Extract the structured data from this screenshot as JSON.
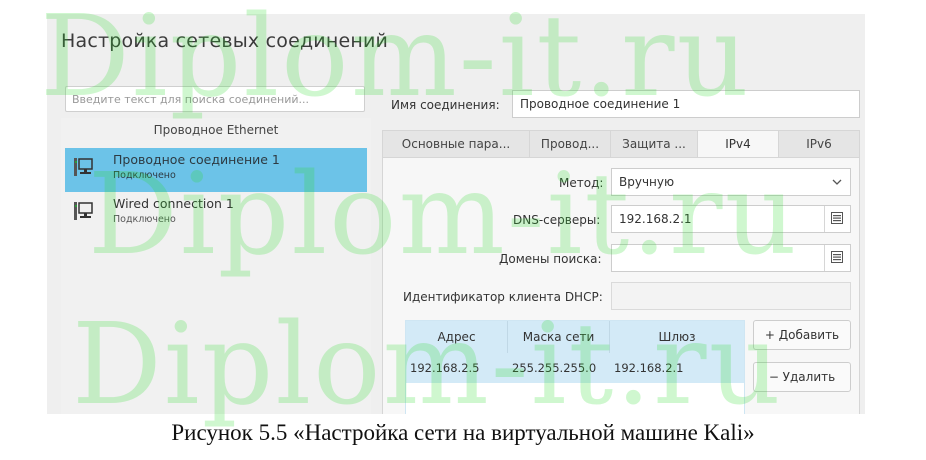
{
  "dialog": {
    "title": "Настройка сетевых соединений"
  },
  "search": {
    "placeholder": "Введите текст для поиска соединений..."
  },
  "connections": {
    "group_header": "Проводное Ethernet",
    "items": [
      {
        "name": "Проводное соединение 1",
        "status": "Подключено",
        "selected": true,
        "icon": "network-wired-icon"
      },
      {
        "name": "Wired connection 1",
        "status": "Подключено",
        "selected": false,
        "icon": "network-wired-icon"
      }
    ]
  },
  "editor": {
    "connection_name_label": "Имя соединения:",
    "connection_name_value": "Проводное соединение 1",
    "tabs": [
      {
        "label": "Основные пара...",
        "active": false
      },
      {
        "label": "Провод...",
        "active": false
      },
      {
        "label": "Защита ...",
        "active": false
      },
      {
        "label": "IPv4",
        "active": true
      },
      {
        "label": "IPv6",
        "active": false
      }
    ],
    "ipv4": {
      "method_label": "Метод:",
      "method_value": "Вручную",
      "dns_label": "DNS-серверы:",
      "dns_value": "192.168.2.1",
      "search_domains_label": "Домены поиска:",
      "search_domains_value": "",
      "dhcp_client_id_label": "Идентификатор клиента DHCP:",
      "dhcp_client_id_value": "",
      "addresses": {
        "columns": [
          "Адрес",
          "Маска сети",
          "Шлюз"
        ],
        "rows": [
          [
            "192.168.2.5",
            "255.255.255.0",
            "192.168.2.1"
          ]
        ]
      },
      "add_button": "+ Добавить",
      "remove_button": "− Удалить"
    }
  },
  "watermark": {
    "text": "Diplom-it.ru"
  },
  "caption": "Рисунок 5.5 «Настройка сети на виртуальной машине Kali»",
  "colors": {
    "selection": "#6cc3e8",
    "table_row": "#d3eaf7",
    "watermark": "#2bdc2b"
  }
}
